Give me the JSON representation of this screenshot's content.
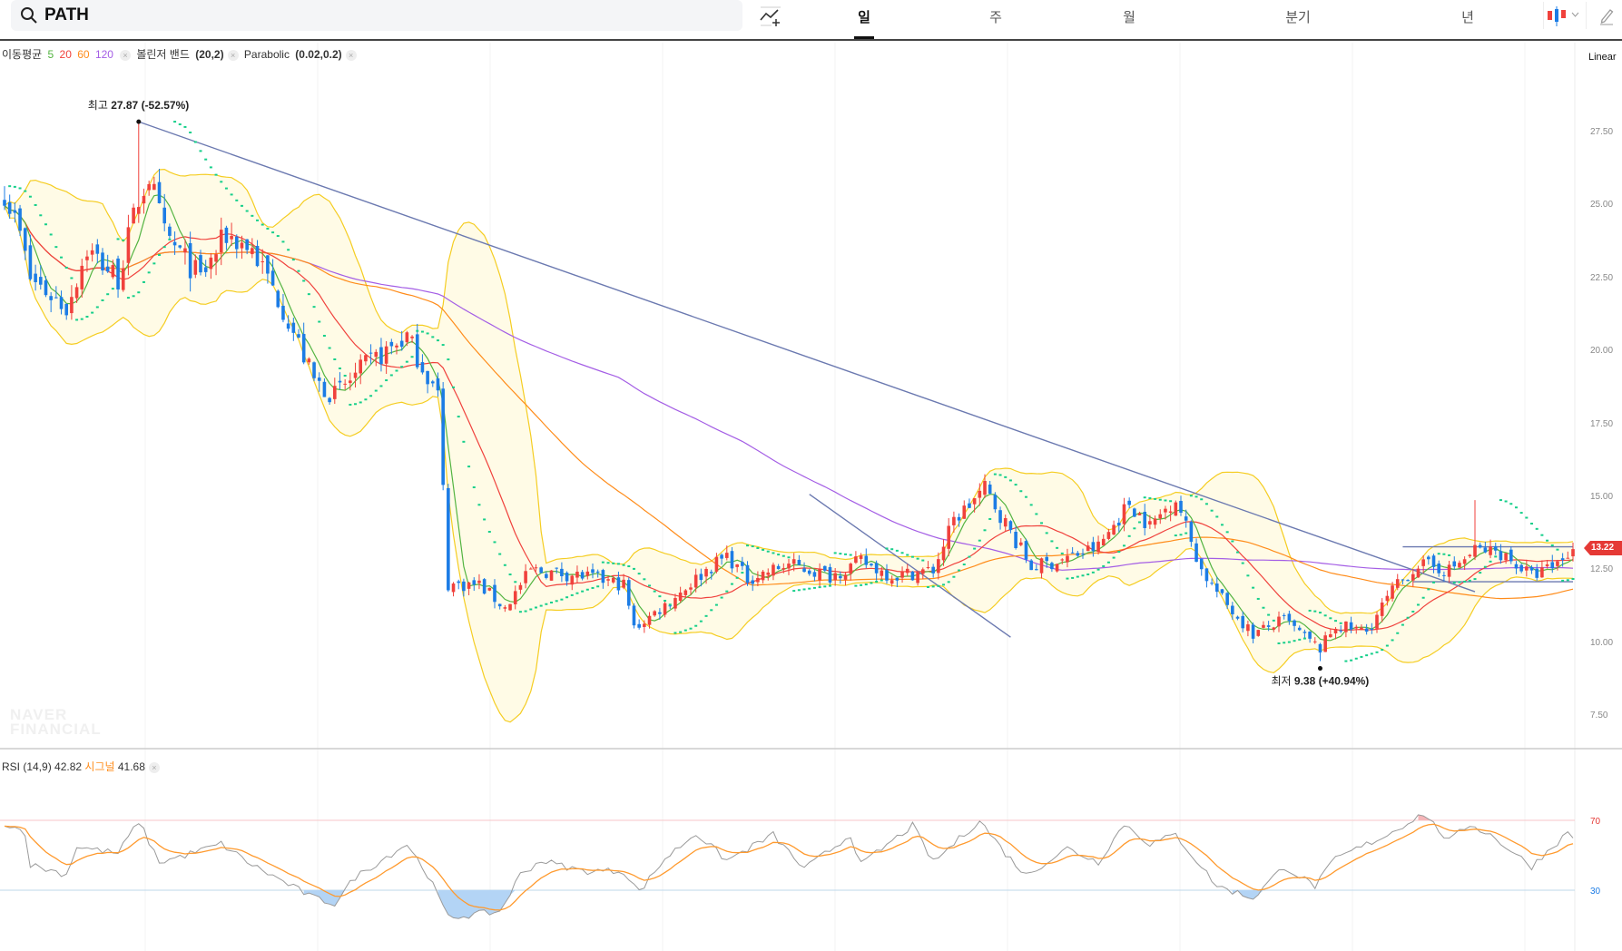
{
  "search": {
    "query": "PATH"
  },
  "toolbar": {
    "tabs": [
      {
        "label": "일",
        "active": true
      },
      {
        "label": "주"
      },
      {
        "label": "월"
      },
      {
        "label": "분기"
      },
      {
        "label": "년"
      }
    ],
    "chart_type_icon": "candlestick-icon",
    "draw_icon": "pencil-icon",
    "indicator_icon": "add-indicator-icon"
  },
  "legend": {
    "ma_label": "이동평균",
    "ma_periods": [
      "5",
      "20",
      "60",
      "120"
    ],
    "bb_label": "볼린저 밴드",
    "bb_params": "(20,2)",
    "psar_label": "Parabolic",
    "psar_params": "(0.02,0.2)",
    "close": "×"
  },
  "rsi_legend": {
    "label": "RSI (14,9)",
    "value": "42.82",
    "signal_label": "시그널",
    "signal_value": "41.68"
  },
  "scale_label": "Linear",
  "watermark": [
    "NAVER",
    "FINANCIAL"
  ],
  "colors": {
    "up": "#f0413c",
    "down": "#1c7ce5",
    "ma5": "#53b441",
    "ma20": "#f0413c",
    "ma60": "#ff8c1a",
    "ma120": "#a45ee5",
    "bb": "#f5cd22",
    "bb_fill": "#fffbe6",
    "psar": "#16cf8a",
    "trend": "#6b79b0",
    "rsi": "#9a9a9a",
    "signal": "#ff9a2e"
  },
  "chart_data": {
    "type": "candlestick",
    "bars": 305,
    "ylim": [
      6.6,
      30.5
    ],
    "yticks": [
      "27.50",
      "25.00",
      "22.50",
      "20.00",
      "17.50",
      "15.00",
      "12.50",
      "10.00",
      "7.50"
    ],
    "last_price": "13.22",
    "high": {
      "label": "최고",
      "value": "27.87",
      "pct": "(-52.57%)",
      "index": 26,
      "price": 27.87
    },
    "low": {
      "label": "최저",
      "value": "9.38",
      "pct": "(+40.94%)",
      "index": 255,
      "price": 9.38
    },
    "close_anchors": [
      [
        0,
        25.5
      ],
      [
        3,
        24
      ],
      [
        5,
        22.5
      ],
      [
        12,
        21.5
      ],
      [
        16,
        23.5
      ],
      [
        22,
        22.5
      ],
      [
        26,
        25.2
      ],
      [
        28,
        26
      ],
      [
        31,
        24
      ],
      [
        38,
        22.5
      ],
      [
        43,
        24
      ],
      [
        48,
        23.5
      ],
      [
        54,
        21.5
      ],
      [
        60,
        19
      ],
      [
        64,
        18.5
      ],
      [
        70,
        19.5
      ],
      [
        78,
        20.5
      ],
      [
        84,
        18.5
      ],
      [
        86,
        12
      ],
      [
        92,
        12
      ],
      [
        97,
        11.2
      ],
      [
        102,
        12.5
      ],
      [
        112,
        12.3
      ],
      [
        120,
        12
      ],
      [
        122,
        10.5
      ],
      [
        128,
        11.3
      ],
      [
        136,
        12.5
      ],
      [
        140,
        13
      ],
      [
        144,
        12.2
      ],
      [
        152,
        12.7
      ],
      [
        160,
        12.3
      ],
      [
        166,
        12.8
      ],
      [
        172,
        12.3
      ],
      [
        180,
        12.5
      ],
      [
        184,
        14.2
      ],
      [
        190,
        15.3
      ],
      [
        195,
        13.8
      ],
      [
        199,
        12.6
      ],
      [
        204,
        12.8
      ],
      [
        212,
        13.3
      ],
      [
        218,
        14.8
      ],
      [
        222,
        14
      ],
      [
        227,
        15
      ],
      [
        232,
        12.5
      ],
      [
        236,
        11.5
      ],
      [
        242,
        10.3
      ],
      [
        248,
        10.8
      ],
      [
        252,
        10.2
      ],
      [
        255,
        9.8
      ],
      [
        258,
        10.6
      ],
      [
        264,
        10.4
      ],
      [
        269,
        11.8
      ],
      [
        274,
        12.7
      ],
      [
        280,
        12.5
      ],
      [
        284,
        13
      ],
      [
        285,
        13.2
      ],
      [
        290,
        13.1
      ],
      [
        296,
        12.3
      ],
      [
        300,
        12.6
      ],
      [
        304,
        13.22
      ]
    ],
    "spikes": [
      [
        285,
        14.9
      ]
    ],
    "trendlines": [
      [
        [
          26,
          27.87
        ],
        [
          285,
          11.76
        ]
      ],
      [
        [
          156,
          15.1
        ],
        [
          195,
          10.2
        ]
      ],
      [
        [
          271,
          13.3
        ],
        [
          304,
          13.3
        ]
      ],
      [
        [
          273,
          12.1
        ],
        [
          304,
          12.1
        ]
      ]
    ],
    "rsi": {
      "ylim": [
        0,
        100
      ],
      "levels": [
        "70",
        "30"
      ],
      "anchors": [
        [
          0,
          68.6
        ],
        [
          4,
          63
        ],
        [
          5,
          44.5
        ],
        [
          12,
          39
        ],
        [
          14,
          55
        ],
        [
          18,
          53
        ],
        [
          22,
          51
        ],
        [
          26,
          69.5
        ],
        [
          30,
          46
        ],
        [
          35,
          50
        ],
        [
          42,
          56.5
        ],
        [
          48,
          44.5
        ],
        [
          54,
          35
        ],
        [
          60,
          25.5
        ],
        [
          64,
          22.4
        ],
        [
          68,
          37.6
        ],
        [
          78,
          56.5
        ],
        [
          82,
          39
        ],
        [
          86,
          14.3
        ],
        [
          96,
          17.8
        ],
        [
          100,
          39
        ],
        [
          104,
          47
        ],
        [
          112,
          41
        ],
        [
          120,
          41
        ],
        [
          123,
          29
        ],
        [
          128,
          48
        ],
        [
          134,
          62.6
        ],
        [
          140,
          47
        ],
        [
          149,
          61.7
        ],
        [
          155,
          42
        ],
        [
          164,
          61.7
        ],
        [
          166,
          44.5
        ],
        [
          176,
          67
        ],
        [
          180,
          46
        ],
        [
          189,
          70
        ],
        [
          194,
          51
        ],
        [
          198,
          38.5
        ],
        [
          206,
          54
        ],
        [
          212,
          46
        ],
        [
          217,
          68
        ],
        [
          222,
          56.5
        ],
        [
          227,
          61.7
        ],
        [
          235,
          32.4
        ],
        [
          242,
          25.5
        ],
        [
          248,
          43.6
        ],
        [
          254,
          32.4
        ],
        [
          258,
          48
        ],
        [
          268,
          61.7
        ],
        [
          275,
          74
        ],
        [
          280,
          58
        ],
        [
          284,
          67.8
        ],
        [
          288,
          61.7
        ],
        [
          296,
          43.6
        ],
        [
          300,
          55
        ],
        [
          303,
          62.6
        ],
        [
          304,
          61
        ]
      ]
    }
  }
}
